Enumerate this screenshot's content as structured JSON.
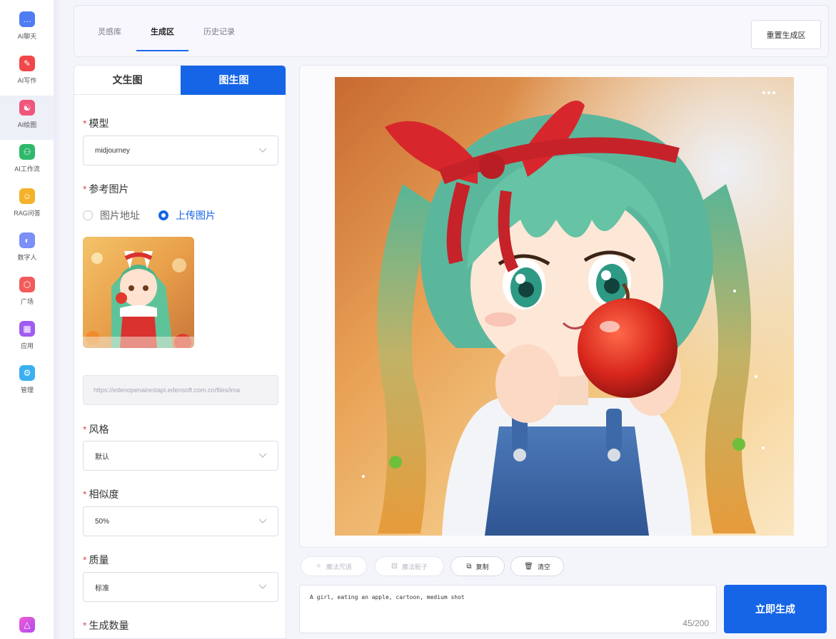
{
  "nav": {
    "items": [
      {
        "label": "AI聊天",
        "icon": "chat-icon",
        "color": "#4f7cf3",
        "glyph": "…"
      },
      {
        "label": "AI写作",
        "icon": "pen-icon",
        "color": "#f0474a",
        "glyph": "✎"
      },
      {
        "label": "AI绘图",
        "icon": "palette-icon",
        "color": "#f0557a",
        "glyph": "☯"
      },
      {
        "label": "AI工作流",
        "icon": "workflow-icon",
        "color": "#2fb86b",
        "glyph": "⚇"
      },
      {
        "label": "RAG问答",
        "icon": "qa-icon",
        "color": "#f2b22a",
        "glyph": "☺"
      },
      {
        "label": "数字人",
        "icon": "digital-human-icon",
        "color": "#7b8ff7",
        "glyph": "◐"
      },
      {
        "label": "广场",
        "icon": "plaza-icon",
        "color": "#f25b5b",
        "glyph": "⬡"
      },
      {
        "label": "应用",
        "icon": "apps-icon",
        "color": "#a05cf0",
        "glyph": "▦"
      },
      {
        "label": "管理",
        "icon": "settings-icon",
        "color": "#3ab0f0",
        "glyph": "⚙"
      }
    ],
    "active_index": 2,
    "bottom_icon": "triangle-logo-icon"
  },
  "topbar": {
    "tabs": [
      "灵感库",
      "生成区",
      "历史记录"
    ],
    "active_tab": 1,
    "reset_label": "重置生成区"
  },
  "form": {
    "mode_tabs": [
      "文生图",
      "图生图"
    ],
    "active_mode": 1,
    "model_label": "模型",
    "model_value": "midjourney",
    "ref_label": "参考图片",
    "radio_url": "图片地址",
    "radio_upload": "上传图片",
    "radio_selected": "upload",
    "url_value": "https://edenopenairestapi.edensoft.com.cn/files/ima",
    "style_label": "风格",
    "style_value": "默认",
    "similarity_label": "相似度",
    "similarity_value": "50%",
    "quality_label": "质量",
    "quality_value": "标准",
    "count_label": "生成数量"
  },
  "actions": {
    "magic_words": "魔法咒语",
    "magic_dice": "魔法骰子",
    "copy": "复制",
    "clear": "清空"
  },
  "prompt": {
    "text": "A girl, eating an apple, cartoon, medium shot",
    "count": "45/200"
  },
  "generate_label": "立即生成",
  "colors": {
    "accent": "#1565e6",
    "required": "#e34d59"
  }
}
